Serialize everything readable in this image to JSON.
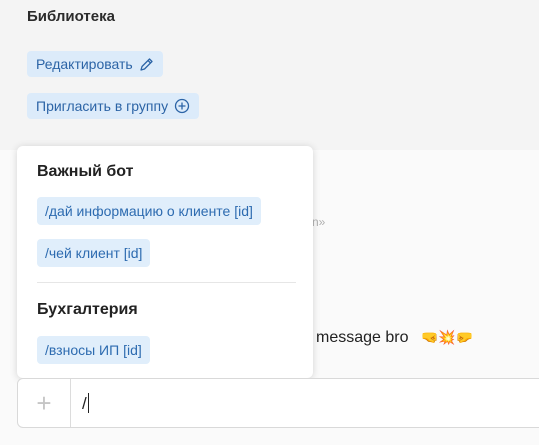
{
  "library": {
    "title": "Библиотека",
    "edit_label": "Редактировать",
    "invite_label": "Пригласить в группу"
  },
  "chat": {
    "quote_fragment": "n»",
    "message_fragment": "message bro",
    "message_emojis": "🤜💥🤛"
  },
  "commands_popup": {
    "groups": [
      {
        "title": "Важный бот",
        "commands": [
          "/дай информацию о клиенте [id]",
          "/чей клиент [id]"
        ]
      },
      {
        "title": "Бухгалтерия",
        "commands": [
          "/взносы ИП [id]"
        ]
      }
    ]
  },
  "composer": {
    "add_symbol": "+",
    "value": "/"
  },
  "colors": {
    "chip_bg": "#dcebfa",
    "chip_text": "#2c64a6"
  }
}
